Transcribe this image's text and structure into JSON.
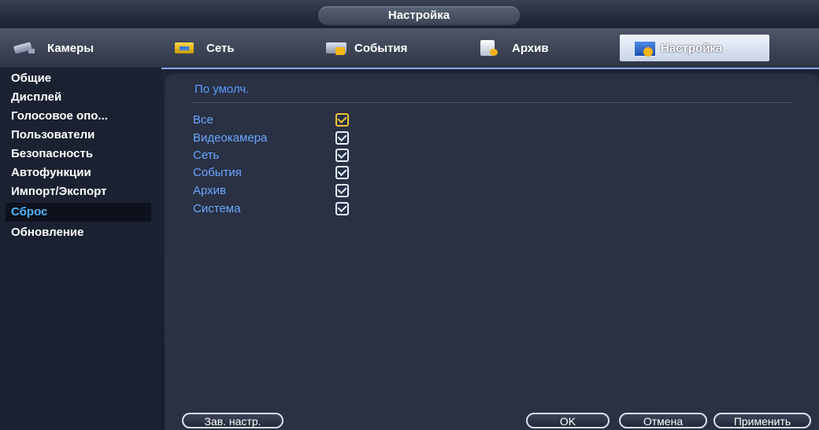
{
  "window": {
    "title": "Настройка"
  },
  "tabs": [
    {
      "label": "Камеры",
      "icon": "camera-icon"
    },
    {
      "label": "Сеть",
      "icon": "network-icon"
    },
    {
      "label": "События",
      "icon": "events-icon"
    },
    {
      "label": "Архив",
      "icon": "archive-icon"
    },
    {
      "label": "Настройка",
      "icon": "settings-icon",
      "active": true
    }
  ],
  "sidebar": {
    "items": [
      {
        "label": "Общие"
      },
      {
        "label": "Дисплей"
      },
      {
        "label": "Голосовое опо..."
      },
      {
        "label": "Пользователи"
      },
      {
        "label": "Безопасность"
      },
      {
        "label": "Автофункции"
      },
      {
        "label": "Импорт/Экспорт"
      },
      {
        "label": "Сброс",
        "active": true
      },
      {
        "label": "Обновление"
      }
    ]
  },
  "panel": {
    "title": "По умолч.",
    "options": [
      {
        "label": "Все",
        "checked": true
      },
      {
        "label": "Видеокамера",
        "checked": true
      },
      {
        "label": "Сеть",
        "checked": true
      },
      {
        "label": "События",
        "checked": true
      },
      {
        "label": "Архив",
        "checked": true
      },
      {
        "label": "Система",
        "checked": true
      }
    ]
  },
  "buttons": {
    "factory_defaults": "Зав. настр.",
    "ok": "OK",
    "cancel": "Отмена",
    "apply": "Применить"
  },
  "colors": {
    "accent": "#5b9cff",
    "active_menu_text": "#4fb3ff",
    "checkbox_highlight": "#f1c232"
  }
}
